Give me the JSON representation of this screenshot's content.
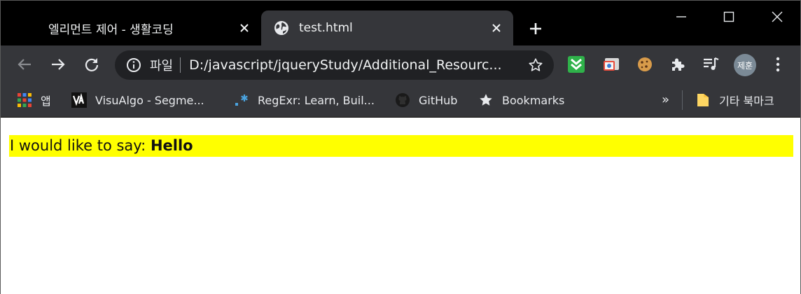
{
  "tabs": [
    {
      "title": "엘리먼트 제어 - 생활코딩",
      "active": false
    },
    {
      "title": "test.html",
      "active": true
    }
  ],
  "omnibox": {
    "chip": "파일",
    "url": "D:/javascript/jqueryStudy/Additional_Resourc..."
  },
  "profile": {
    "initials": "제훈"
  },
  "bookmarks": [
    {
      "label": "앱",
      "icon": "apps-grid-icon"
    },
    {
      "label": "VisuAlgo - Segme...",
      "icon": "visualgo-icon"
    },
    {
      "label": "RegExr: Learn, Buil...",
      "icon": "regexr-icon"
    },
    {
      "label": "GitHub",
      "icon": "github-icon"
    },
    {
      "label": "Bookmarks",
      "icon": "star-icon"
    }
  ],
  "bookmarks_more": "»",
  "other_bookmarks": {
    "label": "기타 북마크",
    "icon": "folder-icon"
  },
  "page": {
    "prefix": "I would like to say: ",
    "emphasis": "Hello"
  },
  "colors": {
    "highlight": "#ffff00",
    "toolbar": "#35363a",
    "omnibox": "#202124"
  }
}
